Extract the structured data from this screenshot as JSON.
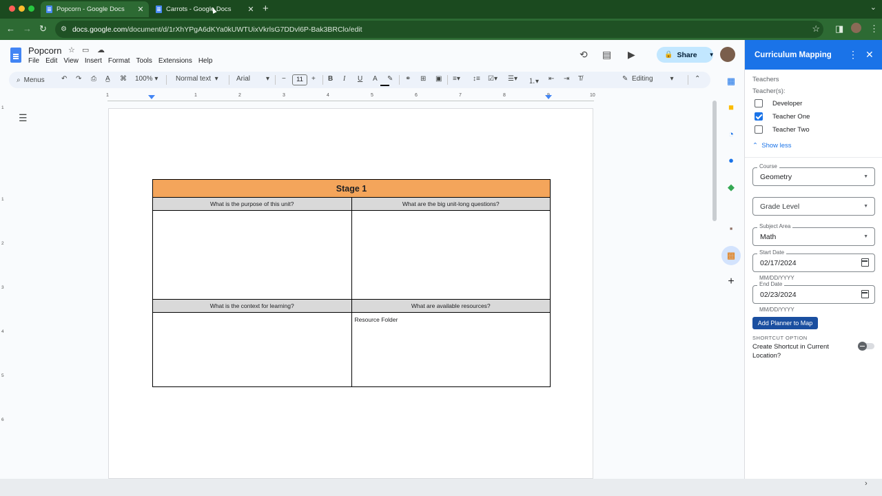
{
  "browser": {
    "tabs": [
      {
        "title": "Popcorn - Google Docs",
        "active": true
      },
      {
        "title": "Carrots - Google Docs",
        "active": false
      }
    ],
    "url_host": "docs.google.com",
    "url_path": "/document/d/1rXhYPgA6dKYa0kUWTUixVkrlsG7DDvl6P-Bak3BRClo/edit"
  },
  "docs": {
    "title": "Popcorn",
    "menu": [
      "File",
      "Edit",
      "View",
      "Insert",
      "Format",
      "Tools",
      "Extensions",
      "Help"
    ],
    "share_label": "Share",
    "toolbar": {
      "search_label": "Menus",
      "zoom": "100%",
      "style": "Normal text",
      "font": "Arial",
      "font_size": "11",
      "mode": "Editing"
    },
    "ruler": [
      "1",
      "1",
      "2",
      "3",
      "4",
      "5",
      "6",
      "7",
      "8",
      "9",
      "10"
    ],
    "vruler": [
      "1",
      "1",
      "2",
      "3",
      "4",
      "5",
      "6"
    ],
    "stage": {
      "heading": "Stage 1",
      "q1": "What is the purpose of this unit?",
      "q2": "What are the big unit-long questions?",
      "q3": "What is the context for learning?",
      "q4": "What are available resources?",
      "a4": "Resource Folder"
    }
  },
  "panel": {
    "title": "Curriculum Mapping",
    "teachers_heading": "Teachers",
    "teachers_label": "Teacher(s):",
    "teachers": [
      {
        "name": "Developer",
        "checked": false
      },
      {
        "name": "Teacher One",
        "checked": true
      },
      {
        "name": "Teacher Two",
        "checked": false
      }
    ],
    "show_less": "Show less",
    "course_label": "Course",
    "course_value": "Geometry",
    "grade_placeholder": "Grade Level",
    "subject_label": "Subject Area",
    "subject_value": "Math",
    "start_label": "Start Date",
    "start_value": "02/17/2024",
    "end_label": "End Date",
    "end_value": "02/23/2024",
    "date_hint": "MM/DD/YYYY",
    "add_button": "Add Planner to Map",
    "shortcut_label": "SHORTCUT OPTION",
    "shortcut_text": "Create Shortcut in Current Location?"
  },
  "colors": {
    "stage_header": "#f4a55b",
    "question_row": "#d9d9d9",
    "panel_header": "#1a73e8",
    "browser_frame": "#2d6a33"
  }
}
